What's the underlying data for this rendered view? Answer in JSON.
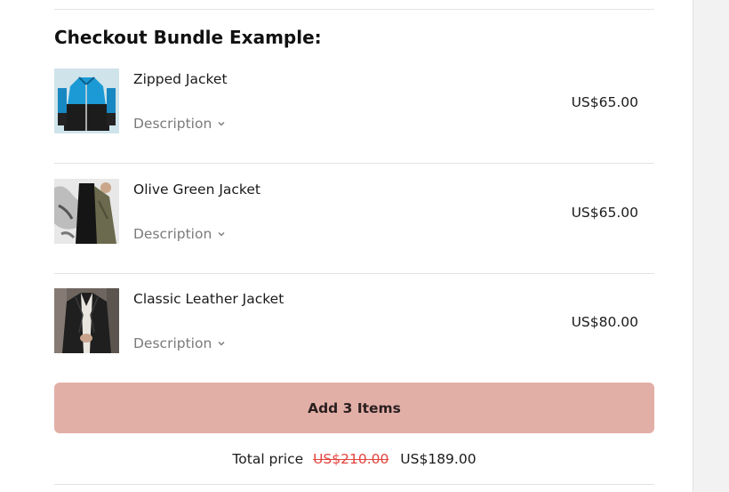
{
  "bundle": {
    "title": "Checkout Bundle Example:",
    "items": [
      {
        "name": "Zipped Jacket",
        "description_label": "Description",
        "price": "US$65.00"
      },
      {
        "name": "Olive Green Jacket",
        "description_label": "Description",
        "price": "US$65.00"
      },
      {
        "name": "Classic Leather Jacket",
        "description_label": "Description",
        "price": "US$80.00"
      }
    ],
    "add_button_label": "Add 3 Items",
    "total": {
      "label": "Total price",
      "original_price": "US$210.00",
      "discounted_price": "US$189.00"
    }
  },
  "colors": {
    "button_bg": "#e2afa7",
    "strikethrough_price": "#e2453f",
    "muted_text": "#7a7a7a"
  }
}
